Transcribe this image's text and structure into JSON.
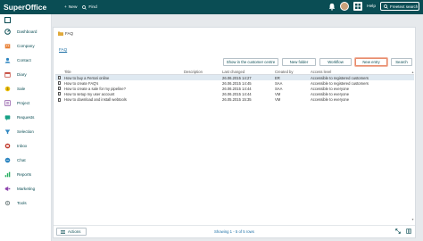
{
  "app": {
    "title": "SuperOffice"
  },
  "topbar": {
    "new_label": "New",
    "find_label": "Find",
    "help_label": "Help",
    "search_label": "Freetext search"
  },
  "sidebar": {
    "items": [
      {
        "label": "Dashboard",
        "icon": "dashboard-icon"
      },
      {
        "label": "Company",
        "icon": "company-icon"
      },
      {
        "label": "Contact",
        "icon": "contact-icon"
      },
      {
        "label": "Diary",
        "icon": "diary-icon"
      },
      {
        "label": "Sale",
        "icon": "sale-icon"
      },
      {
        "label": "Project",
        "icon": "project-icon"
      },
      {
        "label": "Requests",
        "icon": "requests-icon"
      },
      {
        "label": "Selection",
        "icon": "selection-icon"
      },
      {
        "label": "Inbox",
        "icon": "inbox-icon"
      },
      {
        "label": "Chat",
        "icon": "chat-icon"
      },
      {
        "label": "Reports",
        "icon": "reports-icon"
      },
      {
        "label": "Marketing",
        "icon": "marketing-icon"
      },
      {
        "label": "Tools",
        "icon": "tools-icon"
      }
    ]
  },
  "main": {
    "folder_title": "FAQ",
    "breadcrumb_link": "FAQ",
    "buttons": {
      "show_customer_centre": "Show in the customer centre",
      "new_folder": "New folder",
      "workflow": "Workflow",
      "new_entry": "New entry",
      "search": "Search"
    },
    "columns": [
      "Title",
      "Description",
      "Last changed",
      "Created by",
      "Access level"
    ],
    "rows": [
      {
        "title": "How to buy a Ferrari online",
        "description": "",
        "last_changed": "26.06.2015 14:27",
        "created_by": "ER",
        "access": "Accessible to registered customers",
        "selected": true
      },
      {
        "title": "How to create FAQ's",
        "description": "",
        "last_changed": "26.06.2015 14:45",
        "created_by": "SAA",
        "access": "Accessible to registered customers",
        "selected": false
      },
      {
        "title": "How to create a sale for my pipeline?",
        "description": "",
        "last_changed": "26.06.2015 14:44",
        "created_by": "SAA",
        "access": "Accessible to everyone",
        "selected": false
      },
      {
        "title": "How to setup my user account",
        "description": "",
        "last_changed": "26.06.2015 14:44",
        "created_by": "VM",
        "access": "Accessible to everyone",
        "selected": false
      },
      {
        "title": "How to download and install webtools",
        "description": "",
        "last_changed": "26.05.2015 15:35",
        "created_by": "VM",
        "access": "Accessible to everyone",
        "selected": false
      }
    ],
    "footer": {
      "actions_label": "Actions",
      "showing_text": "Showing 1 - 5 of 5 rows"
    }
  },
  "colors": {
    "topbar_bg": "#0a4d54",
    "accent_text": "#0a4d54",
    "link": "#1d6fa5",
    "active_button_border": "#e78a6a",
    "selected_row": "#dfe9f1"
  }
}
